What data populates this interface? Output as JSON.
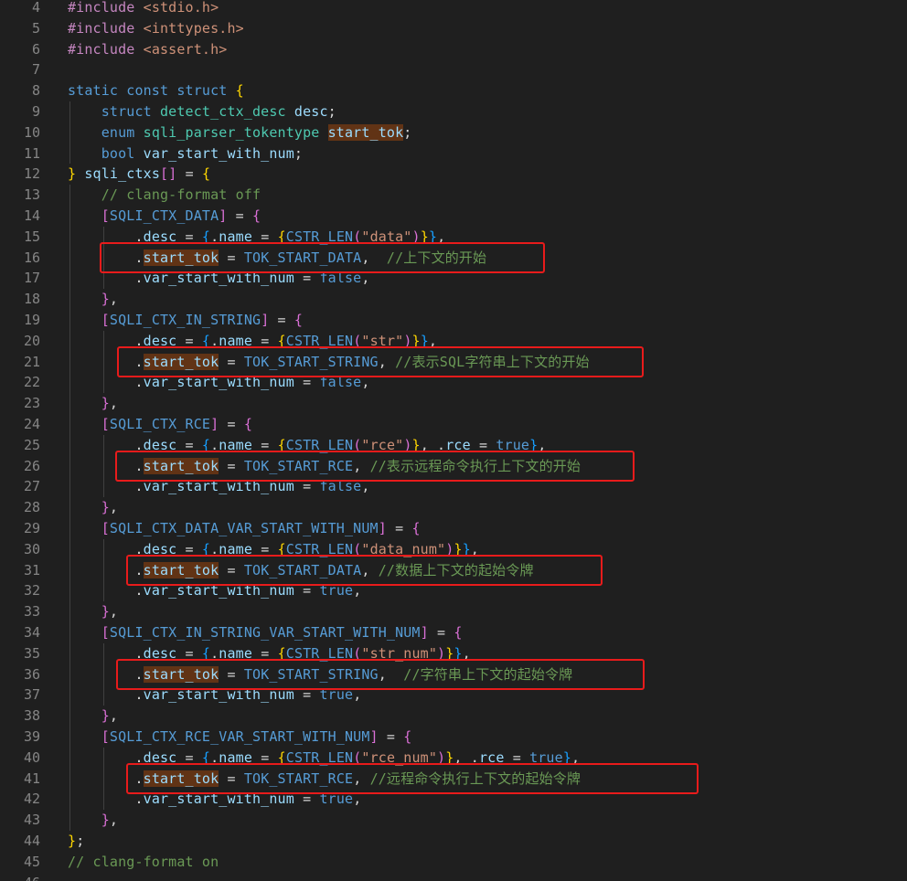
{
  "editor": {
    "colors": {
      "background": "#1f1f1f",
      "line_number": "#858585",
      "highlight_box": "#e81b1b",
      "selection_highlight": "#613315"
    },
    "first_line_number": 4,
    "lines": [
      {
        "n": "4",
        "tokens": [
          [
            "pp",
            "#include "
          ],
          [
            "str",
            "<stdio.h>"
          ]
        ]
      },
      {
        "n": "5",
        "tokens": [
          [
            "pp",
            "#include "
          ],
          [
            "str",
            "<inttypes.h>"
          ]
        ]
      },
      {
        "n": "6",
        "tokens": [
          [
            "pp",
            "#include "
          ],
          [
            "str",
            "<assert.h>"
          ]
        ]
      },
      {
        "n": "7",
        "tokens": []
      },
      {
        "n": "8",
        "tokens": [
          [
            "kw",
            "static const struct "
          ],
          [
            "b1",
            "{"
          ]
        ]
      },
      {
        "n": "9",
        "tokens": [
          [
            "def",
            "    "
          ],
          [
            "kw",
            "struct "
          ],
          [
            "ty",
            "detect_ctx_desc "
          ],
          [
            "id",
            "desc"
          ],
          [
            "def",
            ";"
          ]
        ]
      },
      {
        "n": "10",
        "tokens": [
          [
            "def",
            "    "
          ],
          [
            "kw",
            "enum "
          ],
          [
            "ty",
            "sqli_parser_tokentype "
          ],
          [
            "hl",
            "start_tok"
          ],
          [
            "def",
            ";"
          ]
        ]
      },
      {
        "n": "11",
        "tokens": [
          [
            "def",
            "    "
          ],
          [
            "kw",
            "bool "
          ],
          [
            "id",
            "var_start_with_num"
          ],
          [
            "def",
            ";"
          ]
        ]
      },
      {
        "n": "12",
        "tokens": [
          [
            "b1",
            "} "
          ],
          [
            "id",
            "sqli_ctxs"
          ],
          [
            "b2",
            "[]"
          ],
          [
            "def",
            " = "
          ],
          [
            "b1",
            "{"
          ]
        ]
      },
      {
        "n": "13",
        "tokens": [
          [
            "def",
            "    "
          ],
          [
            "cm",
            "// clang-format off"
          ]
        ]
      },
      {
        "n": "14",
        "tokens": [
          [
            "def",
            "    "
          ],
          [
            "b2",
            "["
          ],
          [
            "mac",
            "SQLI_CTX_DATA"
          ],
          [
            "b2",
            "]"
          ],
          [
            "def",
            " = "
          ],
          [
            "b2",
            "{"
          ]
        ]
      },
      {
        "n": "15",
        "tokens": [
          [
            "def",
            "        ."
          ],
          [
            "id",
            "desc"
          ],
          [
            "def",
            " = "
          ],
          [
            "b3",
            "{"
          ],
          [
            "def",
            "."
          ],
          [
            "id",
            "name"
          ],
          [
            "def",
            " = "
          ],
          [
            "b1",
            "{"
          ],
          [
            "mac",
            "CSTR_LEN"
          ],
          [
            "b2",
            "("
          ],
          [
            "str",
            "\"data\""
          ],
          [
            "b2",
            ")"
          ],
          [
            "b1",
            "}"
          ],
          [
            "b3",
            "}"
          ],
          [
            "def",
            ","
          ]
        ]
      },
      {
        "n": "16",
        "tokens": [
          [
            "def",
            "        ."
          ],
          [
            "hl",
            "start_tok"
          ],
          [
            "def",
            " = "
          ],
          [
            "mac",
            "TOK_START_DATA"
          ],
          [
            "def",
            ",  "
          ],
          [
            "cm",
            "//上下文的开始"
          ]
        ]
      },
      {
        "n": "17",
        "tokens": [
          [
            "def",
            "        ."
          ],
          [
            "id",
            "var_start_with_num"
          ],
          [
            "def",
            " = "
          ],
          [
            "kw",
            "false"
          ],
          [
            "def",
            ","
          ]
        ]
      },
      {
        "n": "18",
        "tokens": [
          [
            "def",
            "    "
          ],
          [
            "b2",
            "}"
          ],
          [
            "def",
            ","
          ]
        ]
      },
      {
        "n": "19",
        "tokens": [
          [
            "def",
            "    "
          ],
          [
            "b2",
            "["
          ],
          [
            "mac",
            "SQLI_CTX_IN_STRING"
          ],
          [
            "b2",
            "]"
          ],
          [
            "def",
            " = "
          ],
          [
            "b2",
            "{"
          ]
        ]
      },
      {
        "n": "20",
        "tokens": [
          [
            "def",
            "        ."
          ],
          [
            "id",
            "desc"
          ],
          [
            "def",
            " = "
          ],
          [
            "b3",
            "{"
          ],
          [
            "def",
            "."
          ],
          [
            "id",
            "name"
          ],
          [
            "def",
            " = "
          ],
          [
            "b1",
            "{"
          ],
          [
            "mac",
            "CSTR_LEN"
          ],
          [
            "b2",
            "("
          ],
          [
            "str",
            "\"str\""
          ],
          [
            "b2",
            ")"
          ],
          [
            "b1",
            "}"
          ],
          [
            "b3",
            "}"
          ],
          [
            "def",
            ","
          ]
        ]
      },
      {
        "n": "21",
        "tokens": [
          [
            "def",
            "        ."
          ],
          [
            "hl",
            "start_tok"
          ],
          [
            "def",
            " = "
          ],
          [
            "mac",
            "TOK_START_STRING"
          ],
          [
            "def",
            ", "
          ],
          [
            "cm",
            "//表示SQL字符串上下文的开始"
          ]
        ]
      },
      {
        "n": "22",
        "tokens": [
          [
            "def",
            "        ."
          ],
          [
            "id",
            "var_start_with_num"
          ],
          [
            "def",
            " = "
          ],
          [
            "kw",
            "false"
          ],
          [
            "def",
            ","
          ]
        ]
      },
      {
        "n": "23",
        "tokens": [
          [
            "def",
            "    "
          ],
          [
            "b2",
            "}"
          ],
          [
            "def",
            ","
          ]
        ]
      },
      {
        "n": "24",
        "tokens": [
          [
            "def",
            "    "
          ],
          [
            "b2",
            "["
          ],
          [
            "mac",
            "SQLI_CTX_RCE"
          ],
          [
            "b2",
            "]"
          ],
          [
            "def",
            " = "
          ],
          [
            "b2",
            "{"
          ]
        ]
      },
      {
        "n": "25",
        "tokens": [
          [
            "def",
            "        ."
          ],
          [
            "id",
            "desc"
          ],
          [
            "def",
            " = "
          ],
          [
            "b3",
            "{"
          ],
          [
            "def",
            "."
          ],
          [
            "id",
            "name"
          ],
          [
            "def",
            " = "
          ],
          [
            "b1",
            "{"
          ],
          [
            "mac",
            "CSTR_LEN"
          ],
          [
            "b2",
            "("
          ],
          [
            "str",
            "\"rce\""
          ],
          [
            "b2",
            ")"
          ],
          [
            "b1",
            "}"
          ],
          [
            "def",
            ", ."
          ],
          [
            "id",
            "rce"
          ],
          [
            "def",
            " = "
          ],
          [
            "kw",
            "true"
          ],
          [
            "b3",
            "}"
          ],
          [
            "def",
            ","
          ]
        ]
      },
      {
        "n": "26",
        "tokens": [
          [
            "def",
            "        ."
          ],
          [
            "hl",
            "start_tok"
          ],
          [
            "def",
            " = "
          ],
          [
            "mac",
            "TOK_START_RCE"
          ],
          [
            "def",
            ", "
          ],
          [
            "cm",
            "//表示远程命令执行上下文的开始"
          ]
        ]
      },
      {
        "n": "27",
        "tokens": [
          [
            "def",
            "        ."
          ],
          [
            "id",
            "var_start_with_num"
          ],
          [
            "def",
            " = "
          ],
          [
            "kw",
            "false"
          ],
          [
            "def",
            ","
          ]
        ]
      },
      {
        "n": "28",
        "tokens": [
          [
            "def",
            "    "
          ],
          [
            "b2",
            "}"
          ],
          [
            "def",
            ","
          ]
        ]
      },
      {
        "n": "29",
        "tokens": [
          [
            "def",
            "    "
          ],
          [
            "b2",
            "["
          ],
          [
            "mac",
            "SQLI_CTX_DATA_VAR_START_WITH_NUM"
          ],
          [
            "b2",
            "]"
          ],
          [
            "def",
            " = "
          ],
          [
            "b2",
            "{"
          ]
        ]
      },
      {
        "n": "30",
        "tokens": [
          [
            "def",
            "        ."
          ],
          [
            "id",
            "desc"
          ],
          [
            "def",
            " = "
          ],
          [
            "b3",
            "{"
          ],
          [
            "def",
            "."
          ],
          [
            "id",
            "name"
          ],
          [
            "def",
            " = "
          ],
          [
            "b1",
            "{"
          ],
          [
            "mac",
            "CSTR_LEN"
          ],
          [
            "b2",
            "("
          ],
          [
            "str",
            "\"data_num\""
          ],
          [
            "b2",
            ")"
          ],
          [
            "b1",
            "}"
          ],
          [
            "b3",
            "}"
          ],
          [
            "def",
            ","
          ]
        ]
      },
      {
        "n": "31",
        "tokens": [
          [
            "def",
            "        ."
          ],
          [
            "hl",
            "start_tok"
          ],
          [
            "def",
            " = "
          ],
          [
            "mac",
            "TOK_START_DATA"
          ],
          [
            "def",
            ", "
          ],
          [
            "cm",
            "//数据上下文的起始令牌"
          ]
        ]
      },
      {
        "n": "32",
        "tokens": [
          [
            "def",
            "        ."
          ],
          [
            "id",
            "var_start_with_num"
          ],
          [
            "def",
            " = "
          ],
          [
            "kw",
            "true"
          ],
          [
            "def",
            ","
          ]
        ]
      },
      {
        "n": "33",
        "tokens": [
          [
            "def",
            "    "
          ],
          [
            "b2",
            "}"
          ],
          [
            "def",
            ","
          ]
        ]
      },
      {
        "n": "34",
        "tokens": [
          [
            "def",
            "    "
          ],
          [
            "b2",
            "["
          ],
          [
            "mac",
            "SQLI_CTX_IN_STRING_VAR_START_WITH_NUM"
          ],
          [
            "b2",
            "]"
          ],
          [
            "def",
            " = "
          ],
          [
            "b2",
            "{"
          ]
        ]
      },
      {
        "n": "35",
        "tokens": [
          [
            "def",
            "        ."
          ],
          [
            "id",
            "desc"
          ],
          [
            "def",
            " = "
          ],
          [
            "b3",
            "{"
          ],
          [
            "def",
            "."
          ],
          [
            "id",
            "name"
          ],
          [
            "def",
            " = "
          ],
          [
            "b1",
            "{"
          ],
          [
            "mac",
            "CSTR_LEN"
          ],
          [
            "b2",
            "("
          ],
          [
            "str",
            "\"str_num\""
          ],
          [
            "b2",
            ")"
          ],
          [
            "b1",
            "}"
          ],
          [
            "b3",
            "}"
          ],
          [
            "def",
            ","
          ]
        ]
      },
      {
        "n": "36",
        "tokens": [
          [
            "def",
            "        ."
          ],
          [
            "hl",
            "start_tok"
          ],
          [
            "def",
            " = "
          ],
          [
            "mac",
            "TOK_START_STRING"
          ],
          [
            "def",
            ",  "
          ],
          [
            "cm",
            "//字符串上下文的起始令牌"
          ]
        ]
      },
      {
        "n": "37",
        "tokens": [
          [
            "def",
            "        ."
          ],
          [
            "id",
            "var_start_with_num"
          ],
          [
            "def",
            " = "
          ],
          [
            "kw",
            "true"
          ],
          [
            "def",
            ","
          ]
        ]
      },
      {
        "n": "38",
        "tokens": [
          [
            "def",
            "    "
          ],
          [
            "b2",
            "}"
          ],
          [
            "def",
            ","
          ]
        ]
      },
      {
        "n": "39",
        "tokens": [
          [
            "def",
            "    "
          ],
          [
            "b2",
            "["
          ],
          [
            "mac",
            "SQLI_CTX_RCE_VAR_START_WITH_NUM"
          ],
          [
            "b2",
            "]"
          ],
          [
            "def",
            " = "
          ],
          [
            "b2",
            "{"
          ]
        ]
      },
      {
        "n": "40",
        "tokens": [
          [
            "def",
            "        ."
          ],
          [
            "id",
            "desc"
          ],
          [
            "def",
            " = "
          ],
          [
            "b3",
            "{"
          ],
          [
            "def",
            "."
          ],
          [
            "id",
            "name"
          ],
          [
            "def",
            " = "
          ],
          [
            "b1",
            "{"
          ],
          [
            "mac",
            "CSTR_LEN"
          ],
          [
            "b2",
            "("
          ],
          [
            "str",
            "\"rce_num\""
          ],
          [
            "b2",
            ")"
          ],
          [
            "b1",
            "}"
          ],
          [
            "def",
            ", ."
          ],
          [
            "id",
            "rce"
          ],
          [
            "def",
            " = "
          ],
          [
            "kw",
            "true"
          ],
          [
            "b3",
            "}"
          ],
          [
            "def",
            ","
          ]
        ]
      },
      {
        "n": "41",
        "tokens": [
          [
            "def",
            "        ."
          ],
          [
            "hl",
            "start_tok"
          ],
          [
            "def",
            " = "
          ],
          [
            "mac",
            "TOK_START_RCE"
          ],
          [
            "def",
            ", "
          ],
          [
            "cm",
            "//远程命令执行上下文的起始令牌"
          ]
        ]
      },
      {
        "n": "42",
        "tokens": [
          [
            "def",
            "        ."
          ],
          [
            "id",
            "var_start_with_num"
          ],
          [
            "def",
            " = "
          ],
          [
            "kw",
            "true"
          ],
          [
            "def",
            ","
          ]
        ]
      },
      {
        "n": "43",
        "tokens": [
          [
            "def",
            "    "
          ],
          [
            "b2",
            "}"
          ],
          [
            "def",
            ","
          ]
        ]
      },
      {
        "n": "44",
        "tokens": [
          [
            "b1",
            "}"
          ],
          [
            "def",
            ";"
          ]
        ]
      },
      {
        "n": "45",
        "tokens": [
          [
            "cm",
            "// clang-format on"
          ]
        ]
      },
      {
        "n": "46",
        "tokens": []
      }
    ],
    "highlight_boxes": [
      {
        "line": "16"
      },
      {
        "line": "21"
      },
      {
        "line": "26"
      },
      {
        "line": "31"
      },
      {
        "line": "36"
      },
      {
        "line": "41"
      }
    ]
  }
}
